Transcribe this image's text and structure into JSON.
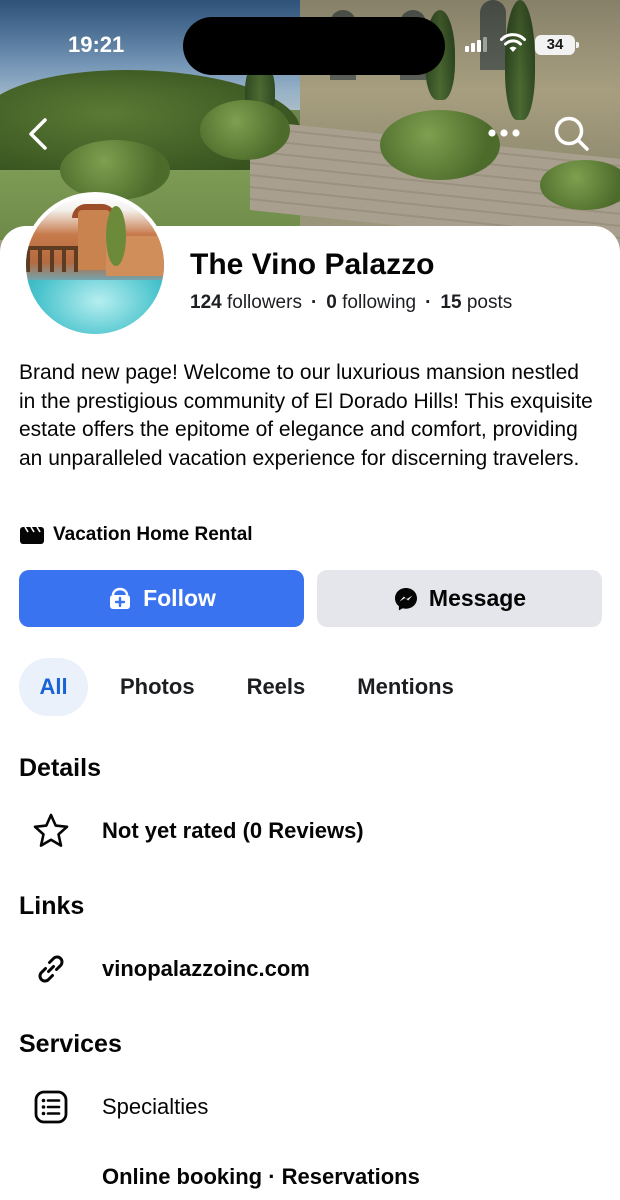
{
  "status_bar": {
    "time": "19:21",
    "battery": "34"
  },
  "cover": {
    "back_icon": "chevron-left-icon",
    "more_icon": "ellipsis-icon",
    "search_icon": "search-icon"
  },
  "profile": {
    "name": "The Vino Palazzo",
    "followers_count": "124",
    "followers_label": "followers",
    "following_count": "0",
    "following_label": "following",
    "posts_count": "15",
    "posts_label": "posts",
    "bio": "Brand new page! Welcome to our luxurious mansion nestled in the prestigious community of El Dorado Hills! This exquisite estate offers the epitome of elegance and comfort, providing an unparalleled vacation experience for discerning travelers.",
    "category": "Vacation Home Rental"
  },
  "actions": {
    "follow_label": "Follow",
    "message_label": "Message"
  },
  "tabs": [
    {
      "label": "All",
      "active": true
    },
    {
      "label": "Photos",
      "active": false
    },
    {
      "label": "Reels",
      "active": false
    },
    {
      "label": "Mentions",
      "active": false
    }
  ],
  "details": {
    "title": "Details",
    "rating_text": "Not yet rated (0 Reviews)",
    "icon": "star-icon"
  },
  "links": {
    "title": "Links",
    "website": "vinopalazzoinc.com",
    "icon": "link-icon"
  },
  "services": {
    "title": "Services",
    "specialties_label": "Specialties",
    "booking_text": "Online booking · Reservations",
    "icon": "list-icon"
  },
  "colors": {
    "accent": "#3a73f0",
    "active_tab_bg": "#ebf1fb",
    "active_tab_text": "#1863d6",
    "secondary_button": "#e4e6eb"
  }
}
